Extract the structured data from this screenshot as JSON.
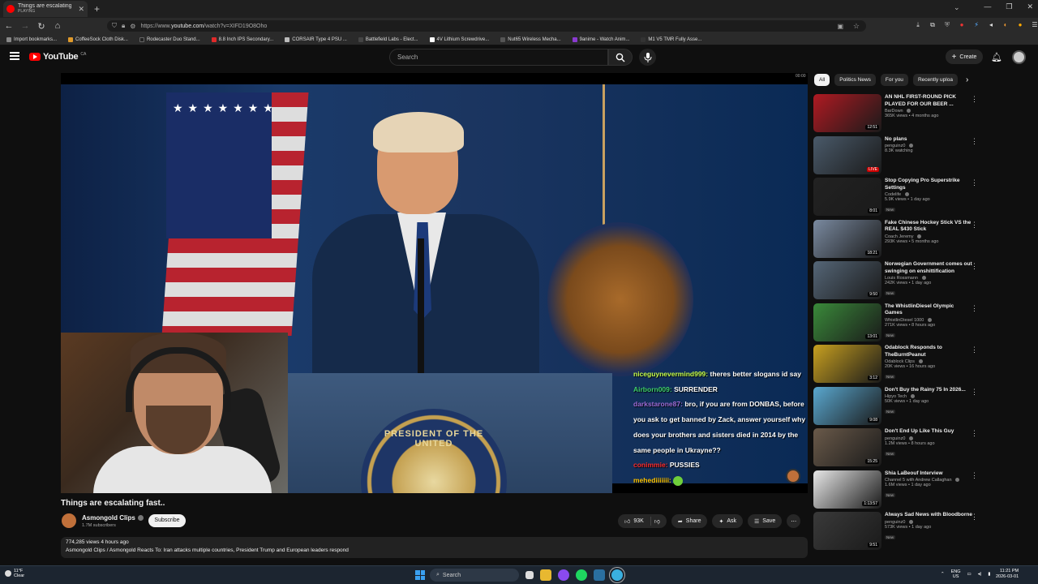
{
  "browser": {
    "tab_title": "Things are escalating fast.. - YouTube",
    "tab_sub": "PLAYING",
    "url_prefix": "https://www.",
    "url_domain": "youtube.com",
    "url_path": "/watch?v=XIFD19O8Oho",
    "bookmarks": [
      "Import bookmarks...",
      "CoffeeSock Cloth Disk...",
      "Rodecaster Duo Stand...",
      "8.8 Inch IPS Secondary...",
      "CORSAIR Type 4 PSU ...",
      "Battlefield Labs - Elect...",
      "4V Lithium Screwdrive...",
      "Nut65 Wireless Mecha...",
      "9anime - Watch Anim...",
      "M1 V5 TMR Fully Asse..."
    ]
  },
  "header": {
    "logo_text": "YouTube",
    "country": "CA",
    "search_placeholder": "Search",
    "create_label": "Create"
  },
  "player": {
    "time_label": "00:00",
    "podium_text": "PRESIDENT OF THE UNITED",
    "chat": [
      {
        "user": "niceguynevermind999:",
        "msg": " theres better slogans id say",
        "color": "u1"
      },
      {
        "user": "Airborn009:",
        "msg": " SURRENDER",
        "color": "u2"
      },
      {
        "user": "darkstarone87:",
        "msg": " bro, if you are from DONBAS, before you ask to get banned by Zack, answer yourself why does your brothers and sisters died in 2014 by the same people in Ukrayne??",
        "color": "u3"
      },
      {
        "user": "conimmie:",
        "msg": " PUSSIES",
        "color": "u4"
      },
      {
        "user": "mehediiiiiii:",
        "msg": "",
        "color": "u5"
      }
    ]
  },
  "video": {
    "title": "Things are escalating fast..",
    "channel": "Asmongold Clips",
    "subscribers": "1.7M subscribers",
    "subscribe_label": "Subscribe",
    "likes": "93K",
    "share_label": "Share",
    "ask_label": "Ask",
    "save_label": "Save",
    "views_time": "774,285 views  4 hours ago",
    "description": "Asmongold Clips / Asmongold Reacts To: Iran attacks multiple countries, President Trump and European leaders respond"
  },
  "chips": [
    "All",
    "Politics News",
    "For you",
    "Recently uploa"
  ],
  "recommendations": [
    {
      "title": "AN NHL FIRST-ROUND PICK PLAYED FOR OUR BEER ...",
      "channel": "BarDown",
      "meta": "365K views • 4 months ago",
      "duration": "12:51",
      "new": false,
      "live": false,
      "thumb": "#b01a22"
    },
    {
      "title": "No plans",
      "channel": "penguinz0",
      "meta": "8.3K watching",
      "duration": "LIVE",
      "new": false,
      "live": true,
      "thumb": "#4a5a6a"
    },
    {
      "title": "Stop Copying Pro Superstrike Settings",
      "channel": "Codelife",
      "meta": "5.9K views • 1 day ago",
      "duration": "8:01",
      "new": true,
      "live": false,
      "thumb": "#222222"
    },
    {
      "title": "Fake Chinese Hockey Stick VS the REAL $430 Stick",
      "channel": "Coach Jeremy",
      "meta": "293K views • 5 months ago",
      "duration": "18:21",
      "new": false,
      "live": false,
      "thumb": "#7a8aa0"
    },
    {
      "title": "Norwegian Government comes out swinging on enshittification",
      "channel": "Louis Rossmann",
      "meta": "242K views • 1 day ago",
      "duration": "9:50",
      "new": true,
      "live": false,
      "thumb": "#556677"
    },
    {
      "title": "The WhistlinDiesel Olympic Games",
      "channel": "WhistlinDiesel 1000",
      "meta": "271K views • 8 hours ago",
      "duration": "13:01",
      "new": true,
      "live": false,
      "thumb": "#3a8a3a"
    },
    {
      "title": "Odablock Responds to TheBurntPeanut",
      "channel": "Odablock Clips",
      "meta": "20K views • 16 hours ago",
      "duration": "3:12",
      "new": true,
      "live": false,
      "thumb": "#c8a020"
    },
    {
      "title": "Don't Buy the Rainy 75 In 2026...",
      "channel": "Hipyo Tech",
      "meta": "50K views • 1 day ago",
      "duration": "9:08",
      "new": true,
      "live": false,
      "thumb": "#5aa8d0"
    },
    {
      "title": "Don't End Up Like This Guy",
      "channel": "penguinz0",
      "meta": "1.2M views • 8 hours ago",
      "duration": "15:25",
      "new": true,
      "live": false,
      "thumb": "#6a5a4a"
    },
    {
      "title": "Shia LaBeouf Interview",
      "channel": "Channel 5 with Andrew Callaghan",
      "meta": "1.6M views • 1 day ago",
      "duration": "1:13:57",
      "new": true,
      "live": false,
      "thumb": "#e8e8e8"
    },
    {
      "title": "Always Sad News with Bloodborne",
      "channel": "penguinz0",
      "meta": "573K views • 1 day ago",
      "duration": "9:51",
      "new": true,
      "live": false,
      "thumb": "#3a3a3a"
    }
  ],
  "new_badge": "New",
  "taskbar": {
    "temp": "11°F",
    "weather": "Clear",
    "search": "Search",
    "lang1": "ENG",
    "lang2": "US",
    "time": "11:21 PM",
    "date": "2026-03-01"
  }
}
